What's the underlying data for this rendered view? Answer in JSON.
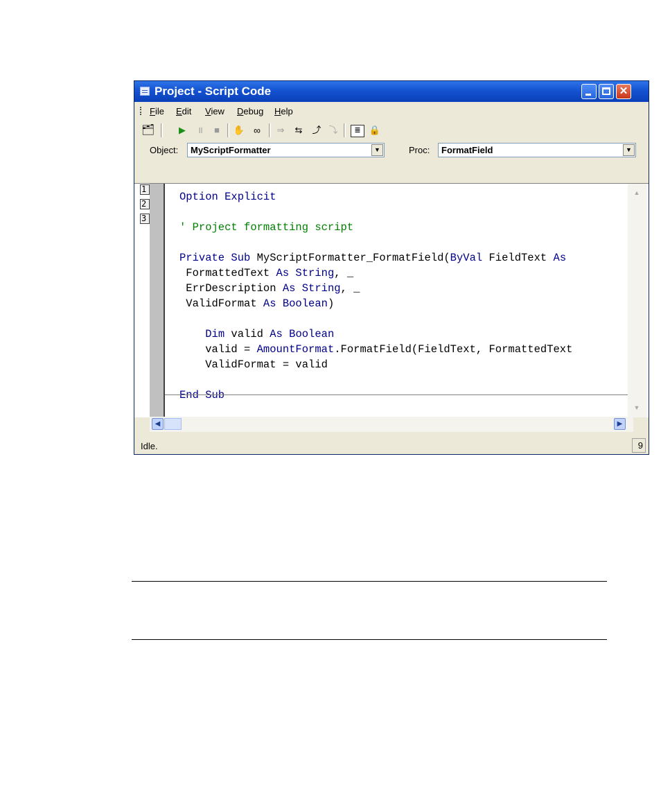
{
  "window": {
    "title": "Project - Script Code",
    "min_glyph": "",
    "max_glyph": "",
    "close_glyph": "✕"
  },
  "menu": [
    "File",
    "Edit",
    "View",
    "Debug",
    "Help"
  ],
  "menu_underline": [
    "F",
    "E",
    "V",
    "D",
    "H"
  ],
  "toolbar": {
    "icons": [
      "project-explorer-icon",
      "run-icon",
      "pause-icon",
      "stop-icon",
      "breakpoint-hand-icon",
      "watch-glasses-icon",
      "step-icon",
      "step-into-icon",
      "step-over-icon",
      "step-out-icon",
      "properties-icon",
      "lock-icon"
    ]
  },
  "object_row": {
    "object_label": "Object:",
    "object_value": "MyScriptFormatter",
    "proc_label": "Proc:",
    "proc_value": "FormatField"
  },
  "line_numbers": [
    "1",
    "2",
    "3"
  ],
  "code_lines": [
    [
      [
        "kw",
        "Option Explicit"
      ]
    ],
    [],
    [
      [
        "cm",
        "' Project formatting script"
      ]
    ],
    [],
    [
      [
        "kw",
        "Private Sub "
      ],
      [
        "",
        "MyScriptFormatter_FormatField("
      ],
      [
        "kw",
        "ByVal"
      ],
      [
        "",
        " FieldText "
      ],
      [
        "kw",
        "As"
      ]
    ],
    [
      [
        "",
        " FormattedText "
      ],
      [
        "kw",
        "As String"
      ],
      [
        "",
        ", _"
      ]
    ],
    [
      [
        "",
        " ErrDescription "
      ],
      [
        "kw",
        "As String"
      ],
      [
        "",
        ", _"
      ]
    ],
    [
      [
        "",
        " ValidFormat "
      ],
      [
        "kw",
        "As Boolean"
      ],
      [
        "",
        ")"
      ]
    ],
    [],
    [
      [
        "",
        "    "
      ],
      [
        "kw",
        "Dim"
      ],
      [
        "",
        " valid "
      ],
      [
        "kw",
        "As Boolean"
      ]
    ],
    [
      [
        "",
        "    valid = "
      ],
      [
        "kw",
        "AmountFormat"
      ],
      [
        "",
        ".FormatField(FieldText, FormattedText"
      ]
    ],
    [
      [
        "",
        "    ValidFormat = valid"
      ]
    ],
    [],
    [
      [
        "kw",
        "End Sub"
      ]
    ]
  ],
  "status": {
    "text": "Idle.",
    "panel": "9"
  }
}
